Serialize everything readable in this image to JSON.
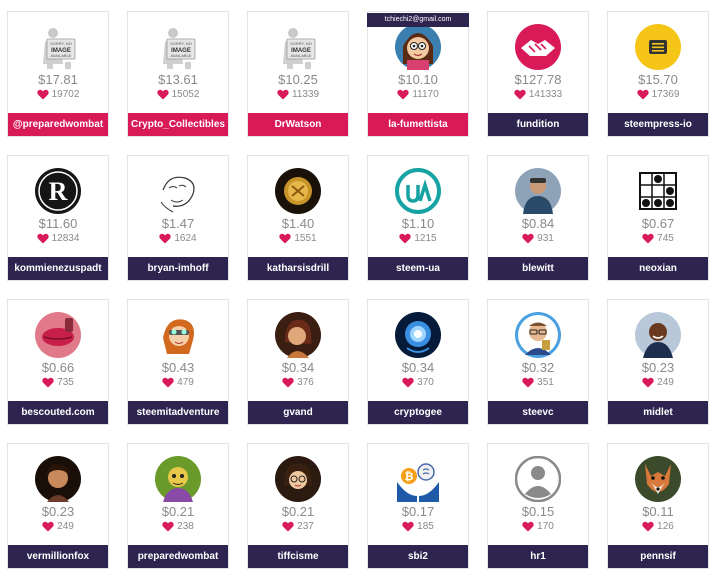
{
  "tooltip": "tchiechi2@gmail.com",
  "rows": [
    [
      {
        "name": "@preparedwombat",
        "amount": "$17.81",
        "votes": "19702",
        "avatar": "no-image-avatar",
        "label_color": "pink"
      },
      {
        "name": "Crypto_Collectibles",
        "amount": "$13.61",
        "votes": "15052",
        "avatar": "no-image-avatar",
        "label_color": "pink"
      },
      {
        "name": "DrWatson",
        "amount": "$10.25",
        "votes": "11339",
        "avatar": "no-image-avatar",
        "label_color": "pink"
      },
      {
        "name": "la-fumettista",
        "amount": "$10.10",
        "votes": "11170",
        "avatar": "cartoon-girl-avatar",
        "label_color": "pink"
      },
      {
        "name": "fundition",
        "amount": "$127.78",
        "votes": "141333",
        "avatar": "handshake-logo-avatar",
        "label_color": "dark"
      },
      {
        "name": "steempress-io",
        "amount": "$15.70",
        "votes": "17369",
        "avatar": "steempress-logo-avatar",
        "label_color": "dark"
      }
    ],
    [
      {
        "name": "kommienezuspadt",
        "amount": "$11.60",
        "votes": "12834",
        "avatar": "r-badge-avatar",
        "label_color": "dark"
      },
      {
        "name": "bryan-imhoff",
        "amount": "$1.47",
        "votes": "1624",
        "avatar": "sketch-face-avatar",
        "label_color": "dark"
      },
      {
        "name": "katharsisdrill",
        "amount": "$1.40",
        "votes": "1551",
        "avatar": "gold-coin-avatar",
        "label_color": "dark"
      },
      {
        "name": "steem-ua",
        "amount": "$1.10",
        "votes": "1215",
        "avatar": "ua-logo-avatar",
        "label_color": "dark"
      },
      {
        "name": "blewitt",
        "amount": "$0.84",
        "votes": "931",
        "avatar": "person-photo-avatar",
        "label_color": "dark"
      },
      {
        "name": "neoxian",
        "amount": "$0.67",
        "votes": "745",
        "avatar": "dot-grid-avatar",
        "label_color": "dark"
      }
    ],
    [
      {
        "name": "bescouted.com",
        "amount": "$0.66",
        "votes": "735",
        "avatar": "lips-photo-avatar",
        "label_color": "dark"
      },
      {
        "name": "steemitadventure",
        "amount": "$0.43",
        "votes": "479",
        "avatar": "redhead-cartoon-avatar",
        "label_color": "dark"
      },
      {
        "name": "gvand",
        "amount": "$0.34",
        "votes": "376",
        "avatar": "woman-photo-avatar",
        "label_color": "dark"
      },
      {
        "name": "cryptogee",
        "amount": "$0.34",
        "votes": "370",
        "avatar": "blue-brain-avatar",
        "label_color": "dark"
      },
      {
        "name": "steevc",
        "amount": "$0.32",
        "votes": "351",
        "avatar": "man-glasses-avatar",
        "label_color": "dark"
      },
      {
        "name": "midlet",
        "amount": "$0.23",
        "votes": "249",
        "avatar": "man-smiling-avatar",
        "label_color": "dark"
      }
    ],
    [
      {
        "name": "vermillionfox",
        "amount": "$0.23",
        "votes": "249",
        "avatar": "dark-portrait-avatar",
        "label_color": "dark"
      },
      {
        "name": "preparedwombat",
        "amount": "$0.21",
        "votes": "238",
        "avatar": "green-portrait-avatar",
        "label_color": "dark"
      },
      {
        "name": "tiffcisme",
        "amount": "$0.21",
        "votes": "237",
        "avatar": "woman-glasses-avatar",
        "label_color": "dark"
      },
      {
        "name": "sbi2",
        "amount": "$0.17",
        "votes": "185",
        "avatar": "hands-coins-avatar",
        "label_color": "dark"
      },
      {
        "name": "hr1",
        "amount": "$0.15",
        "votes": "170",
        "avatar": "default-user-avatar",
        "label_color": "dark"
      },
      {
        "name": "pennsif",
        "amount": "$0.11",
        "votes": "126",
        "avatar": "fox-avatar",
        "label_color": "dark"
      }
    ]
  ],
  "colors": {
    "accent_pink": "#d81a58",
    "label_dark": "#2e2450",
    "heart": "#d81a58",
    "muted_text": "#8a8a8a"
  }
}
